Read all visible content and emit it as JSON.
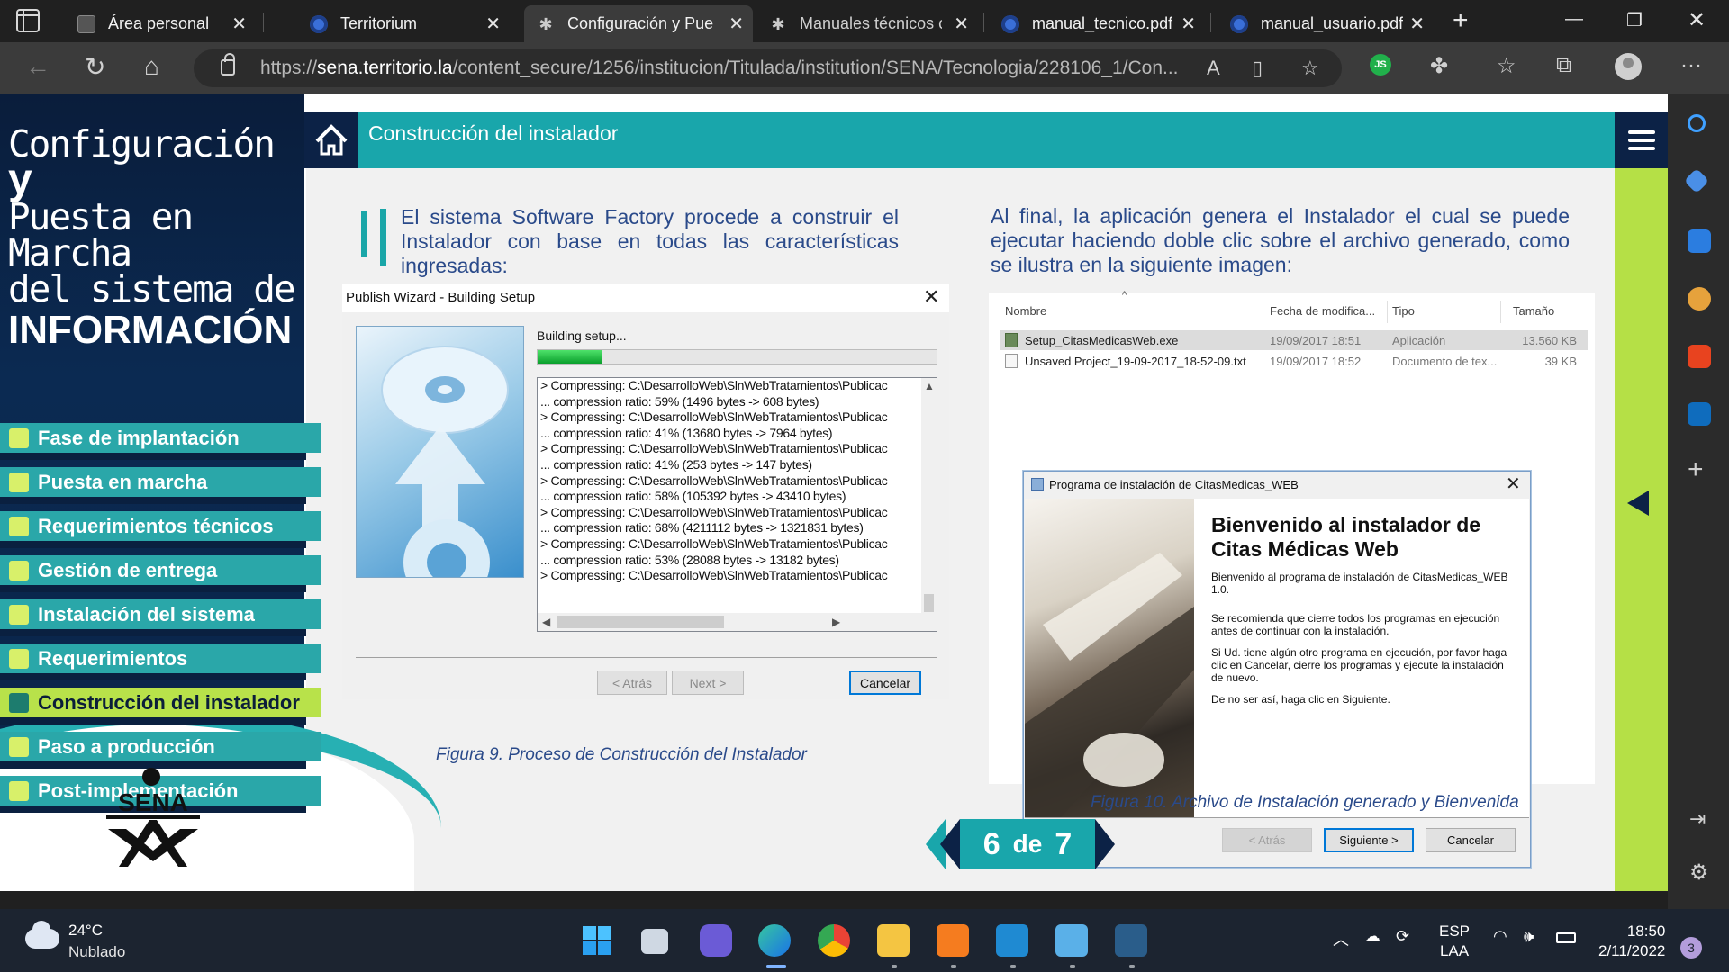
{
  "browser": {
    "tabs": [
      {
        "label": "Área personal"
      },
      {
        "label": "Territorium"
      },
      {
        "label": "Configuración y Pue"
      },
      {
        "label": "Manuales técnicos c"
      },
      {
        "label": "manual_tecnico.pdf"
      },
      {
        "label": "manual_usuario.pdf"
      }
    ],
    "url_prefix": "https://",
    "url_host": "sena.territorio.la",
    "url_path": "/content_secure/1256/institucion/Titulada/institution/SENA/Tecnologia/228106_1/Con...",
    "profile_badge": "JS"
  },
  "sidebar": {
    "title_line1": "Configuración",
    "title_y": "y",
    "title_line2": "Puesta en Marcha",
    "title_line3": "del sistema de",
    "title_line4": "INFORMACIÓN",
    "items": [
      {
        "label": "Fase de implantación"
      },
      {
        "label": "Puesta en marcha"
      },
      {
        "label": "Requerimientos técnicos"
      },
      {
        "label": "Gestión de entrega"
      },
      {
        "label": "Instalación del sistema"
      },
      {
        "label": "Requerimientos"
      },
      {
        "label": "Construcción del instalador"
      },
      {
        "label": "Paso a producción"
      },
      {
        "label": "Post-implementación"
      }
    ],
    "active_item": "Construcción del instalador",
    "logo_text": "SENA"
  },
  "header": {
    "title": "Construcción del instalador"
  },
  "content": {
    "paragraph_left": "El sistema Software Factory procede a construir el Instalador con base en todas las características ingresadas:",
    "paragraph_right": "Al final, la aplicación genera el Instalador el cual se puede ejecutar haciendo doble clic sobre el archivo generado, como se ilustra en la siguiente imagen:",
    "caption_left": "Figura 9. Proceso de Construcción del Instalador",
    "caption_right": "Figura 10. Archivo de Instalación generado y Bienvenida"
  },
  "wizard": {
    "title": "Publish Wizard - Building Setup",
    "status": "Building setup...",
    "progress_fraction": 0.16,
    "log_lines": [
      "> Compressing: C:\\DesarrolloWeb\\SlnWebTratamientos\\Publicac",
      "... compression ratio: 59% (1496 bytes -> 608 bytes)",
      "> Compressing: C:\\DesarrolloWeb\\SlnWebTratamientos\\Publicac",
      "... compression ratio: 41% (13680 bytes -> 7964 bytes)",
      "> Compressing: C:\\DesarrolloWeb\\SlnWebTratamientos\\Publicac",
      "... compression ratio: 41% (253 bytes -> 147 bytes)",
      "> Compressing: C:\\DesarrolloWeb\\SlnWebTratamientos\\Publicac",
      "... compression ratio: 58% (105392 bytes -> 43410 bytes)",
      "> Compressing: C:\\DesarrolloWeb\\SlnWebTratamientos\\Publicac",
      "... compression ratio: 68% (4211112 bytes -> 1321831 bytes)",
      "> Compressing: C:\\DesarrolloWeb\\SlnWebTratamientos\\Publicac",
      "... compression ratio: 53% (28088 bytes -> 13182 bytes)",
      "> Compressing: C:\\DesarrolloWeb\\SlnWebTratamientos\\Publicac"
    ],
    "back_label": "< Atrás",
    "next_label": "Next >",
    "cancel_label": "Cancelar"
  },
  "explorer": {
    "columns": [
      "Nombre",
      "Fecha de modifica...",
      "Tipo",
      "Tamaño"
    ],
    "rows": [
      {
        "name": "Setup_CitasMedicasWeb.exe",
        "date": "19/09/2017 18:51",
        "type": "Aplicación",
        "size": "13.560 KB"
      },
      {
        "name": "Unsaved Project_19-09-2017_18-52-09.txt",
        "date": "19/09/2017 18:52",
        "type": "Documento de tex...",
        "size": "39 KB"
      }
    ]
  },
  "installer": {
    "title": "Programa de instalación de CitasMedicas_WEB",
    "heading_line1": "Bienvenido al instalador de",
    "heading_line2": "Citas Médicas Web",
    "text1": "Bienvenido al programa de instalación de CitasMedicas_WEB 1.0.",
    "text2": "Se recomienda que cierre todos los programas en ejecución antes de continuar con la instalación.",
    "text3": "Si Ud. tiene algún otro programa en ejecución, por favor haga clic en Cancelar, cierre los programas y ejecute la instalación de nuevo.",
    "text4": "De no ser así, haga clic en Siguiente.",
    "back_label": "< Atrás",
    "next_label": "Siguiente >",
    "cancel_label": "Cancelar"
  },
  "pager": {
    "current": "6",
    "separator": "de",
    "total": "7"
  },
  "taskbar": {
    "temperature": "24°C",
    "weather": "Nublado",
    "lang1": "ESP",
    "lang2": "LAA",
    "time": "18:50",
    "date": "2/11/2022",
    "notifications": "3"
  },
  "colors": {
    "teal": "#19a6ab",
    "navy": "#0c2246",
    "lime": "#b5e046",
    "text_blue": "#2a4a8a"
  }
}
